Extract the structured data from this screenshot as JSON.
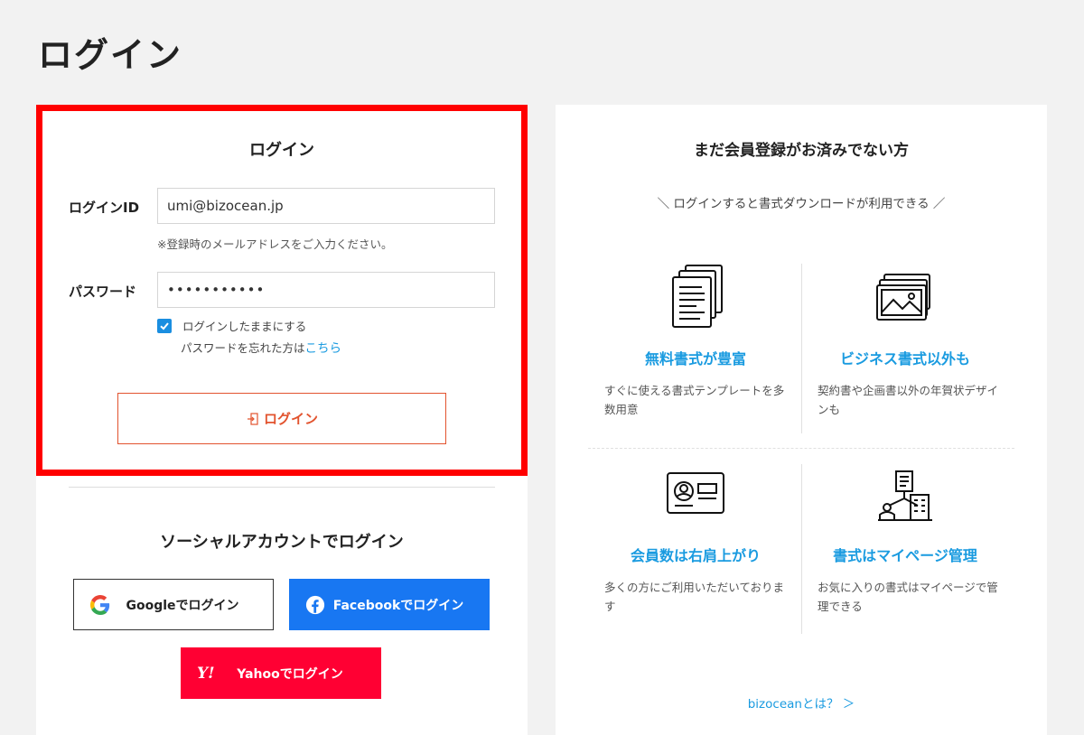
{
  "page_title": "ログイン",
  "login_form": {
    "title": "ログイン",
    "id_label": "ログインID",
    "id_value": "umi@bizocean.jp",
    "id_hint": "※登録時のメールアドレスをご入力ください。",
    "password_label": "パスワード",
    "password_value": "•••••••••••",
    "remember_label": "ログインしたままにする",
    "remember_checked": true,
    "forgot_text": "パスワードを忘れた方は",
    "forgot_link": "こちら",
    "submit_label": "ログイン",
    "accent_color": "#e2532e",
    "highlight_color": "#ff0000"
  },
  "social": {
    "title": "ソーシャルアカウントでログイン",
    "google_label": "Googleでログイン",
    "facebook_label": "Facebookでログイン",
    "yahoo_label": "Yahooでログイン",
    "facebook_color": "#1877f2",
    "yahoo_color": "#ff0033"
  },
  "promo": {
    "title": "まだ会員登録がお済みでない方",
    "subtitle": "＼ ログインすると書式ダウンロードが利用できる ／",
    "features": [
      {
        "icon": "documents-icon",
        "title": "無料書式が豊富",
        "desc": "すぐに使える書式テンプレートを多数用意"
      },
      {
        "icon": "pictures-icon",
        "title": "ビジネス書式以外も",
        "desc": "契約書や企画書以外の年賀状デザインも"
      },
      {
        "icon": "id-card-icon",
        "title": "会員数は右肩上がり",
        "desc": "多くの方にご利用いただいております"
      },
      {
        "icon": "management-icon",
        "title": "書式はマイページ管理",
        "desc": "お気に入りの書式はマイページで管理できる"
      }
    ],
    "about_link": "bizoceanとは？ ＞",
    "accent_color": "#1a9be0"
  }
}
